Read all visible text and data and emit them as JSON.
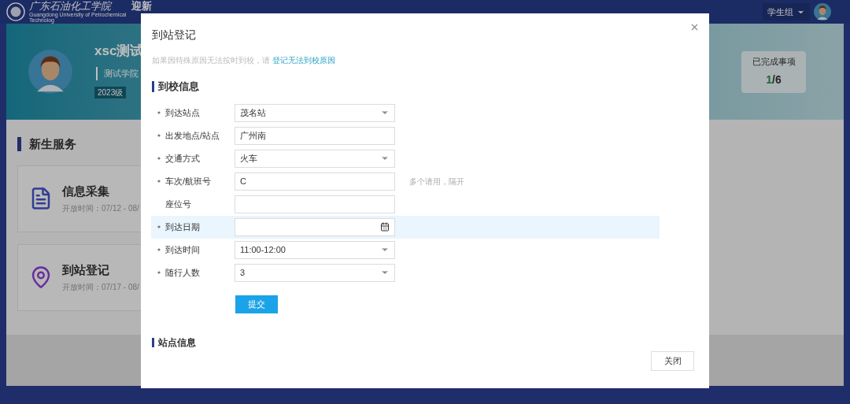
{
  "header": {
    "school_name": "广东石油化工学院",
    "school_name_en": "Guangdong University of Petrochemical Technolog",
    "app_title": "迎新",
    "role_menu": "学生组"
  },
  "profile": {
    "name": "xsc测试",
    "college": "测试学院",
    "grade": "2023级",
    "progress_label": "已完成事项",
    "progress_done": "1",
    "progress_total": "/6"
  },
  "services": {
    "title": "新生服务",
    "items": [
      {
        "kind": "form",
        "title": "信息采集",
        "period": "开放时间：07/12 - 08/"
      },
      {
        "kind": "location",
        "title": "到站登记",
        "period": "开放时间：07/17 - 08/"
      }
    ]
  },
  "dialog": {
    "title": "到站登记",
    "notice": "如果因特殊原因无法按时到校，请",
    "notice_link": "登记无法到校原因",
    "section": "到校信息",
    "fields": [
      {
        "label": "到达站点",
        "kind": "select",
        "value": "茂名站",
        "required": true,
        "focused": false
      },
      {
        "label": "出发地点/站点",
        "kind": "text",
        "value": "广州南",
        "required": true,
        "focused": false
      },
      {
        "label": "交通方式",
        "kind": "select",
        "value": "火车",
        "required": true,
        "focused": false
      },
      {
        "label": "车次/航班号",
        "kind": "text",
        "value": "C",
        "required": true,
        "focused": false,
        "hint": "多个请用，隔开"
      },
      {
        "label": "座位号",
        "kind": "text",
        "required": false,
        "focused": false
      },
      {
        "label": "到达日期",
        "kind": "date",
        "required": true,
        "focused": true
      },
      {
        "label": "到达时间",
        "kind": "select",
        "value": "11:00-12:00",
        "required": true,
        "focused": false
      },
      {
        "label": "随行人数",
        "kind": "select",
        "value": "3",
        "required": true,
        "focused": false
      }
    ],
    "submit": "提交",
    "section2": "站点信息",
    "close_button": "关闭"
  }
}
